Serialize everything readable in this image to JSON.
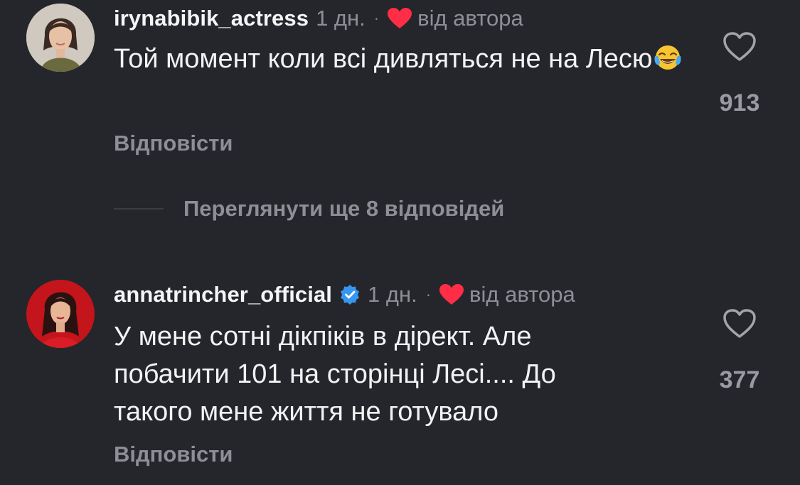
{
  "comments": [
    {
      "username": "irynabibik_actress",
      "time": "1 дн.",
      "separator": "·",
      "author_label": "від автора",
      "verified": false,
      "text": "Той момент коли всі дивляться не на Лесю",
      "emoji_icon": "face-with-tears-of-joy-emoji",
      "like_count": "913",
      "reply_label": "Відповісти"
    },
    {
      "username": "annatrincher_official",
      "time": "1 дн.",
      "separator": "·",
      "author_label": "від автора",
      "verified": true,
      "text": "У мене сотні дікпіків в дірект. Але побачити 101 на сторінці Лесі.... До такого мене життя не готувало",
      "like_count": "377",
      "reply_label": "Відповісти"
    }
  ],
  "view_replies_label": "Переглянути ще 8 відповідей",
  "colors": {
    "background": "#25262b",
    "text": "#f2f2f4",
    "muted": "#8e8f96",
    "heart_red": "#ff2d46",
    "verified_blue": "#3797f0"
  }
}
